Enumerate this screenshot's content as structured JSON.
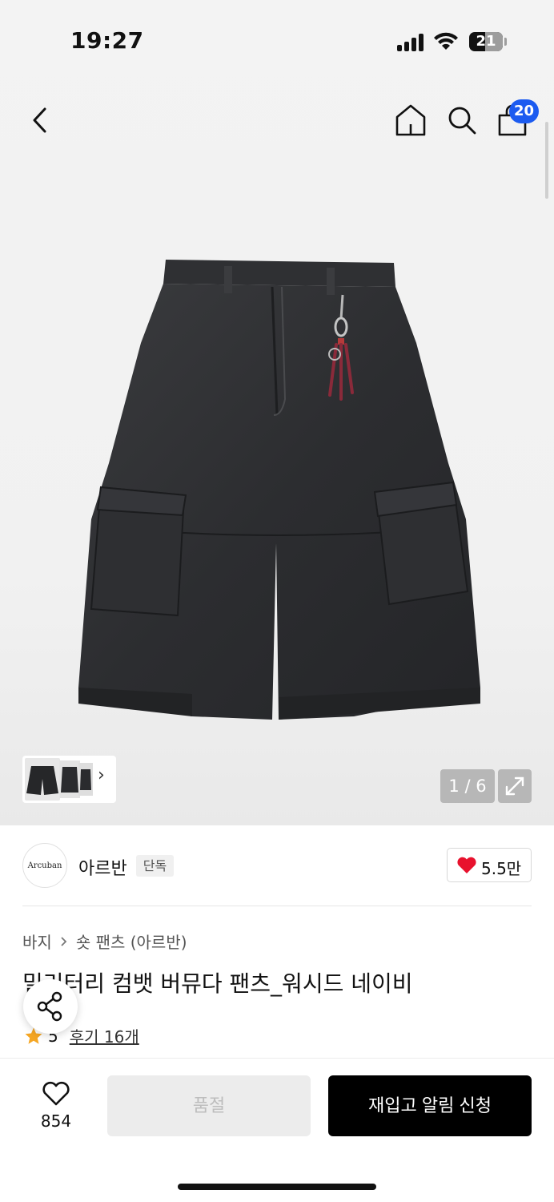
{
  "status_bar": {
    "time": "19:27",
    "battery": "21"
  },
  "nav": {
    "cart_count": "20"
  },
  "gallery": {
    "counter": "1 / 6",
    "thumb_more": "›"
  },
  "brand": {
    "logo_text": "Arcuban",
    "name": "아르반",
    "tag": "단독",
    "likes": "5.5만"
  },
  "breadcrumb": {
    "category": "바지",
    "subcategory": "숏 팬츠 (아르반)"
  },
  "product": {
    "title": "밀리터리 컴뱃 버뮤다 팬츠_워시드 네이비",
    "rating": "5",
    "reviews": "후기 16개"
  },
  "bottom_bar": {
    "wish_count": "854",
    "soldout_label": "품절",
    "restock_label": "재입고 알림 신청"
  },
  "colors": {
    "accent_badge": "#1c5bf0",
    "heart": "#e8112d",
    "star": "#f5a623"
  }
}
